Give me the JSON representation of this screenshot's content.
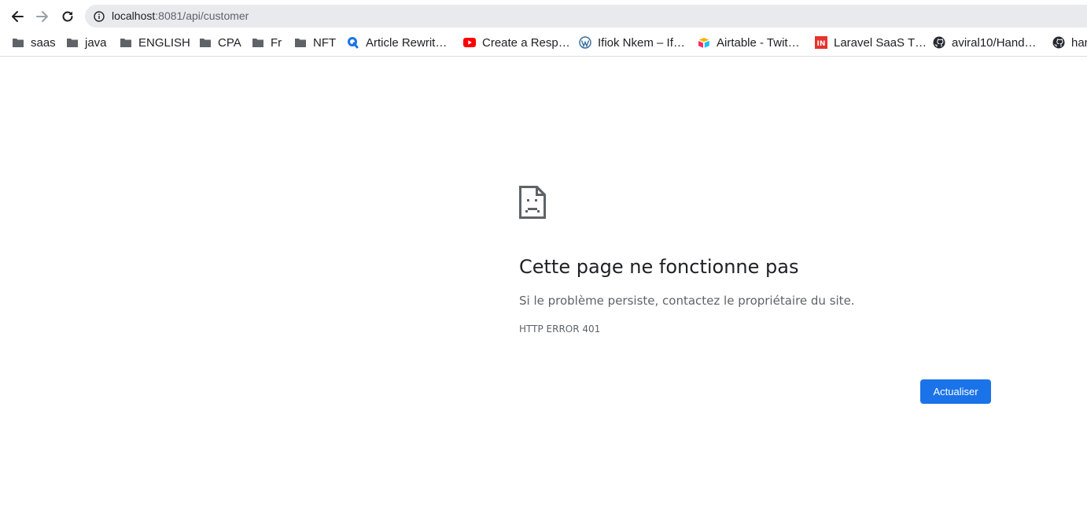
{
  "browser": {
    "url_host": "localhost",
    "url_rest": ":8081/api/customer"
  },
  "bookmarks": [
    {
      "label": "saas",
      "icon": "folder-icon"
    },
    {
      "label": "java",
      "icon": "folder-icon"
    },
    {
      "label": "ENGLISH",
      "icon": "folder-icon"
    },
    {
      "label": "CPA",
      "icon": "folder-icon"
    },
    {
      "label": "Fr",
      "icon": "folder-icon"
    },
    {
      "label": "NFT",
      "icon": "folder-icon"
    },
    {
      "label": "Article Rewrit…",
      "icon": "article-rewriter-icon"
    },
    {
      "label": "Create a Resp…",
      "icon": "youtube-icon"
    },
    {
      "label": "Ifiok Nkem – If…",
      "icon": "wordpress-icon"
    },
    {
      "label": "Airtable - Twit…",
      "icon": "airtable-icon"
    },
    {
      "label": "Laravel SaaS T…",
      "icon": "laravel-icon"
    },
    {
      "label": "aviral10/Hand…",
      "icon": "github-icon"
    },
    {
      "label": "har",
      "icon": "github-icon"
    }
  ],
  "error": {
    "title": "Cette page ne fonctionne pas",
    "message": "Si le problème persiste, contactez le propriétaire du site.",
    "code": "HTTP ERROR 401",
    "reload_label": "Actualiser",
    "icon": "sad-page-icon"
  },
  "colors": {
    "accent": "#1a73e8",
    "omnibox_bg": "#e8eaed",
    "text_primary": "#202124",
    "text_secondary": "#5f6368"
  }
}
